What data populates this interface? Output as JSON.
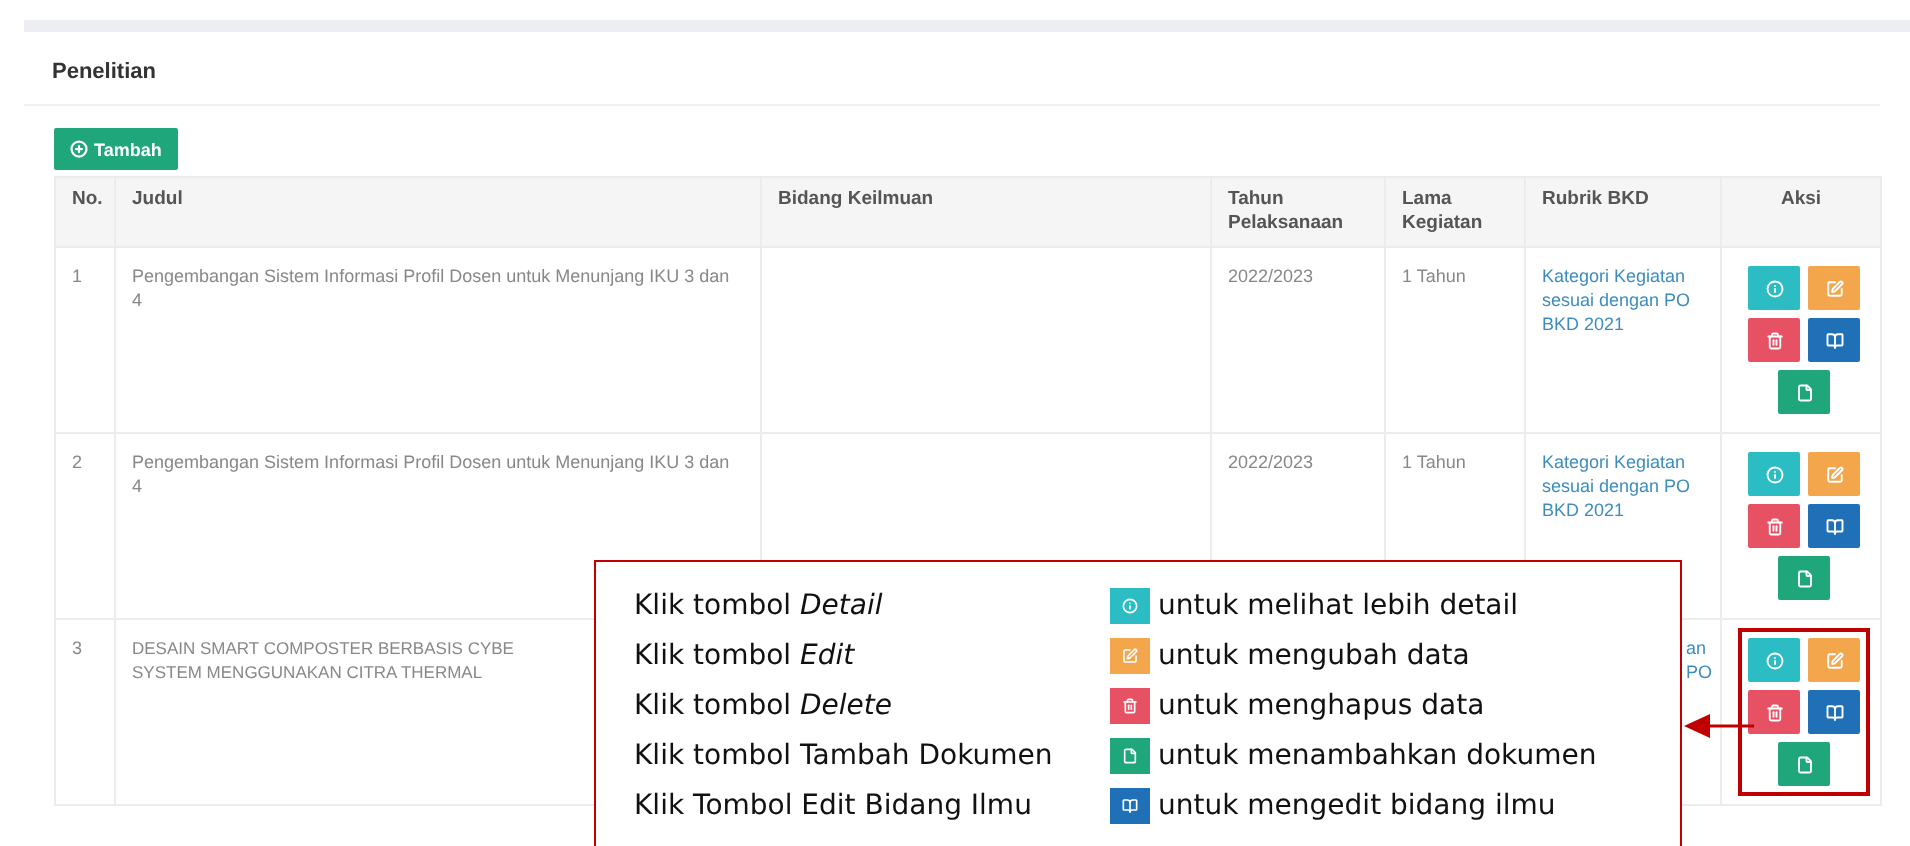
{
  "section_title": "Penelitian",
  "add_button": {
    "label": "Tambah"
  },
  "table": {
    "columns": [
      "No.",
      "Judul",
      "Bidang Keilmuan",
      "Tahun Pelaksanaan",
      "Lama Kegiatan",
      "Rubrik BKD",
      "Aksi"
    ],
    "rows": [
      {
        "no": "1",
        "judul": "Pengembangan Sistem Informasi Profil Dosen untuk Menunjang IKU 3 dan 4",
        "tahun": "2022/2023",
        "lama": "1 Tahun",
        "rubrik": "Kategori Kegiatan sesuai dengan PO BKD 2021",
        "highlighted": false,
        "actions": [
          {
            "kind": "detail"
          },
          {
            "kind": "edit"
          },
          {
            "kind": "delete"
          },
          {
            "kind": "bidang"
          },
          {
            "kind": "dokumen"
          }
        ]
      },
      {
        "no": "2",
        "judul": "Pengembangan Sistem Informasi Profil Dosen untuk Menunjang IKU 3 dan 4",
        "tahun": "2022/2023",
        "lama": "1 Tahun",
        "rubrik": "Kategori Kegiatan sesuai dengan PO BKD 2021",
        "highlighted": false,
        "actions": [
          {
            "kind": "detail"
          },
          {
            "kind": "edit"
          },
          {
            "kind": "delete"
          },
          {
            "kind": "bidang"
          },
          {
            "kind": "dokumen"
          }
        ]
      },
      {
        "no": "3",
        "judul": "DESAIN SMART COMPOSTER BERBASIS CYBE\nSYSTEM MENGGUNAKAN CITRA THERMAL",
        "rubrik": "an\nPO",
        "highlighted": true,
        "actions": [
          {
            "kind": "detail"
          },
          {
            "kind": "edit"
          },
          {
            "kind": "delete"
          },
          {
            "kind": "bidang"
          },
          {
            "kind": "dokumen"
          }
        ]
      }
    ]
  },
  "callout": {
    "items": [
      {
        "label": "Klik tombol *Detail*",
        "kind": "detail",
        "description": "untuk melihat lebih detail"
      },
      {
        "label": "Klik tombol *Edit*",
        "kind": "edit",
        "description": "untuk mengubah data"
      },
      {
        "label": "Klik tombol *Delete*",
        "kind": "delete",
        "description": "untuk menghapus data"
      },
      {
        "label": "Klik tombol Tambah Dokumen",
        "kind": "dokumen",
        "description": "untuk menambahkan dokumen"
      },
      {
        "label": "Klik Tombol Edit Bidang Ilmu",
        "kind": "bidang",
        "description": "untuk mengedit bidang ilmu"
      }
    ]
  }
}
